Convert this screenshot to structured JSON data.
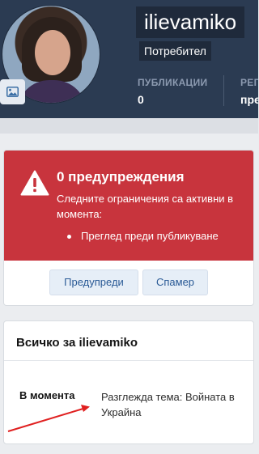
{
  "profile": {
    "username": "ilievamiko",
    "user_title": "Потребител",
    "stats": [
      {
        "label": "ПУБЛИКАЦИИ",
        "value": "0"
      },
      {
        "label": "РЕГ",
        "value": "пре"
      }
    ]
  },
  "warning": {
    "title": "0 предупреждения",
    "text": "Следните ограничения са активни в момента:",
    "items": [
      "Преглед преди публикуване"
    ],
    "accent_color": "#c8343d"
  },
  "actions": {
    "warn_label": "Предупреди",
    "spammer_label": "Спамер"
  },
  "about": {
    "title": "Всичко за ilievamiko",
    "rows": [
      {
        "key": "В момента",
        "value": "Разглежда тема: Войната в Украйна"
      }
    ]
  },
  "colors": {
    "header_bg": "#2b3b52",
    "button_text": "#2a5a96",
    "annotation_arrow": "#e02020"
  }
}
